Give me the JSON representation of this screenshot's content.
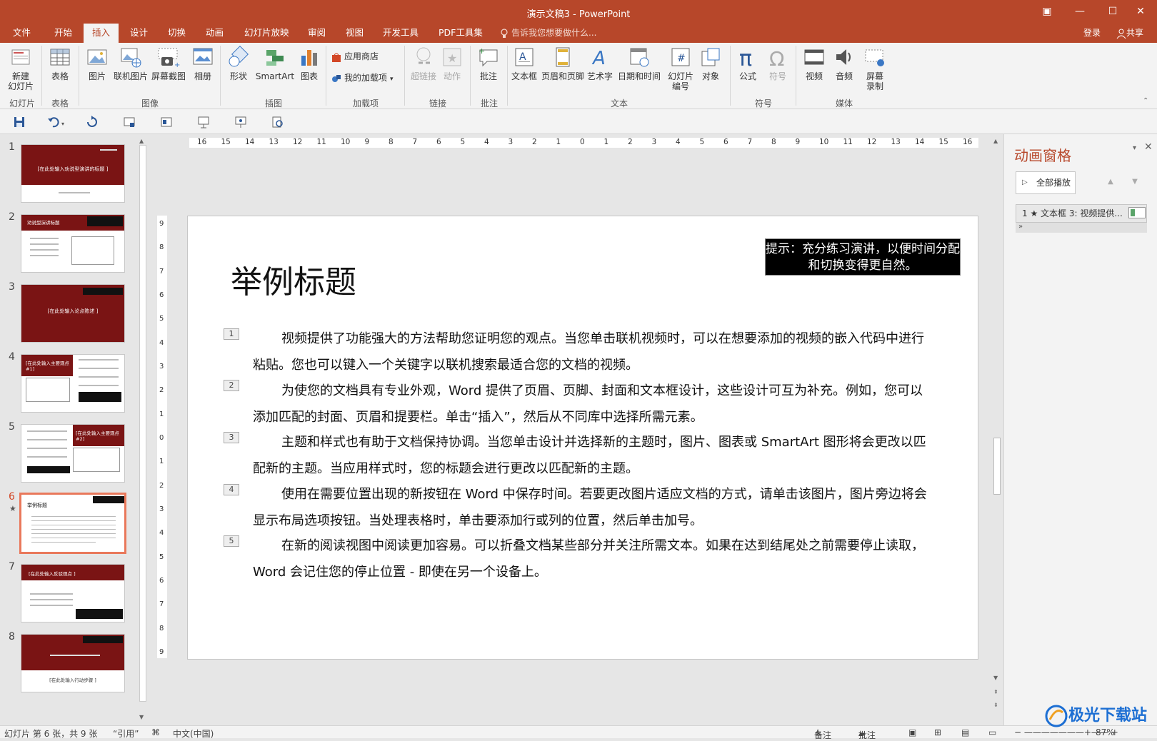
{
  "window": {
    "title": "演示文稿3 - PowerPoint"
  },
  "tabs": [
    "文件",
    "开始",
    "插入",
    "设计",
    "切换",
    "动画",
    "幻灯片放映",
    "审阅",
    "视图",
    "开发工具",
    "PDF工具集"
  ],
  "active_tab": "插入",
  "tellme": "告诉我您想要做什么...",
  "login": "登录",
  "share": "共享",
  "ribbon": {
    "new_slide": "新建\n幻灯片",
    "table": "表格",
    "picture": "图片",
    "online_picture": "联机图片",
    "screenshot": "屏幕截图",
    "album": "相册",
    "shapes": "形状",
    "smartart": "SmartArt",
    "chart": "图表",
    "store": "应用商店",
    "my_addins": "我的加载项",
    "hyperlink": "超链接",
    "action": "动作",
    "comment": "批注",
    "textbox": "文本框",
    "header_footer": "页眉和页脚",
    "wordart": "艺术字",
    "datetime": "日期和时间",
    "slide_number": "幻灯片\n编号",
    "object": "对象",
    "equation": "公式",
    "symbol": "符号",
    "video": "视频",
    "audio": "音频",
    "screen_record": "屏幕\n录制",
    "groups": {
      "slides": "幻灯片",
      "tables": "表格",
      "images": "图像",
      "illustrations": "插图",
      "addins": "加载项",
      "links": "链接",
      "comments": "批注",
      "text": "文本",
      "symbols": "符号",
      "media": "媒体"
    }
  },
  "thumbs": [
    {
      "num": "1",
      "title": "[在此处输入劝说型演讲的标题 ]"
    },
    {
      "num": "2",
      "title": "劝说型演讲标题"
    },
    {
      "num": "3",
      "title": "[在此处输入论点陈述 ]"
    },
    {
      "num": "4",
      "title": "[在此处输入主要观点 #1]"
    },
    {
      "num": "5",
      "title": "[在此处输入主要观点 #2]"
    },
    {
      "num": "6",
      "title": "举例标题"
    },
    {
      "num": "7",
      "title": "[在此处输入反驳观点 ]"
    },
    {
      "num": "8",
      "title": "[在此处输入行动步骤 ]"
    }
  ],
  "slide": {
    "title": "举例标题",
    "hint": "提示：充分练习演讲，以便时间分配和切换变得更自然。",
    "paragraphs": [
      {
        "n": "1",
        "text": "视频提供了功能强大的方法帮助您证明您的观点。当您单击联机视频时，可以在想要添加的视频的嵌入代码中进行粘贴。您也可以键入一个关键字以联机搜索最适合您的文档的视频。"
      },
      {
        "n": "2",
        "text": "为使您的文档具有专业外观，Word 提供了页眉、页脚、封面和文本框设计，这些设计可互为补充。例如，您可以添加匹配的封面、页眉和提要栏。单击“插入”，然后从不同库中选择所需元素。"
      },
      {
        "n": "3",
        "text": "主题和样式也有助于文档保持协调。当您单击设计并选择新的主题时，图片、图表或 SmartArt 图形将会更改以匹配新的主题。当应用样式时，您的标题会进行更改以匹配新的主题。"
      },
      {
        "n": "4",
        "text": "使用在需要位置出现的新按钮在 Word 中保存时间。若要更改图片适应文档的方式，请单击该图片，图片旁边将会显示布局选项按钮。当处理表格时，单击要添加行或列的位置，然后单击加号。"
      },
      {
        "n": "5",
        "text": "在新的阅读视图中阅读更加容易。可以折叠文档某些部分并关注所需文本。如果在达到结尾处之前需要停止读取，Word 会记住您的停止位置 - 即使在另一个设备上。"
      }
    ]
  },
  "anim_pane": {
    "title": "动画窗格",
    "play_all": "全部播放",
    "item": "1 ★ 文本框 3: 视频提供..."
  },
  "status": {
    "slide_info": "幻灯片 第 6 张，共 9 张",
    "quote": "“引用”",
    "lang": "中文(中国)",
    "notes": "备注",
    "comments": "批注",
    "zoom": "87%"
  },
  "watermark": "极光下载站"
}
